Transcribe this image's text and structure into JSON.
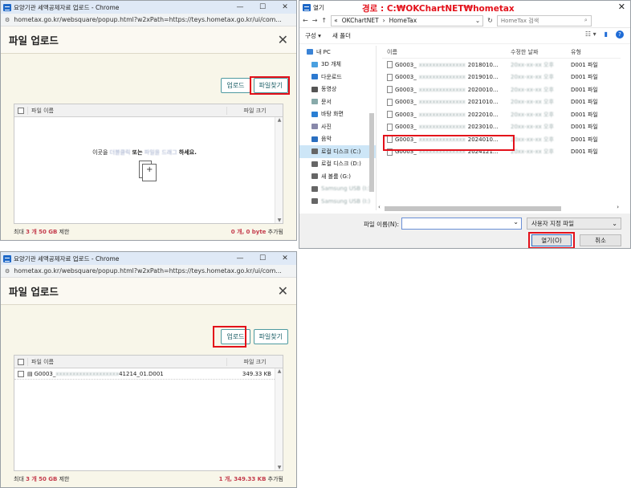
{
  "colors": {
    "highlight": "#e3101a",
    "accent_red": "#c43c4c",
    "teal": "#1b5e66"
  },
  "browser": {
    "title": "요양기관 세액공제자료 업로드 - Chrome",
    "url": "hometax.go.kr/websquare/popup.html?w2xPath=https://teys.hometax.go.kr/ui/com...",
    "minimize": "—",
    "maximize": "☐",
    "close": "✕"
  },
  "upload_before": {
    "heading": "파일 업로드",
    "close": "✕",
    "upload_button": "업로드",
    "find_button": "파일찾기",
    "col_name": "파일 이름",
    "col_size": "파일 크기",
    "hint_pre": "이곳을",
    "hint_blur1": "더블클릭",
    "hint_mid": "또는",
    "hint_blur2": "파일을 드래그",
    "hint_post": "하세요.",
    "footer_pre": "최대",
    "footer_count": "3 개",
    "footer_size": "50 GB",
    "footer_suffix": "제한",
    "added_count": "0 개,",
    "added_size": "0 byte",
    "added_suffix": "추가됨"
  },
  "upload_after": {
    "heading": "파일 업로드",
    "close": "✕",
    "upload_button": "업로드",
    "find_button": "파일찾기",
    "col_name": "파일 이름",
    "col_size": "파일 크기",
    "file_prefix": "G0003_",
    "file_blur": "xxxxxxxxxxxxxxxxxxx",
    "file_suffix": "41214_01.D001",
    "file_size": "349.33 KB",
    "footer_pre": "최대",
    "footer_count": "3 개",
    "footer_size": "50 GB",
    "footer_suffix": "제한",
    "added_count": "1 개,",
    "added_size": "349.33 KB",
    "added_suffix": "추가됨"
  },
  "explorer": {
    "title": "열기",
    "path_note": "경로 : C:₩OKChartNET₩hometax",
    "close": "✕",
    "nav_back": "←",
    "nav_fwd": "→",
    "nav_up": "↑",
    "addr_prefix": "«",
    "addr_1": "OKChartNET",
    "addr_sep": "›",
    "addr_2": "HomeTax",
    "refresh": "↻",
    "search_placeholder": "HomeTax 검색",
    "organize": "구성 ▾",
    "new_folder": "새 폴더",
    "tree": [
      {
        "label": "내 PC",
        "color": "#3a83d6"
      },
      {
        "label": "3D 개체",
        "color": "#4aa0e0"
      },
      {
        "label": "다운로드",
        "color": "#2d7ad0"
      },
      {
        "label": "동영상",
        "color": "#555"
      },
      {
        "label": "문서",
        "color": "#8aa"
      },
      {
        "label": "바탕 화면",
        "color": "#2a7fd4"
      },
      {
        "label": "사진",
        "color": "#88a"
      },
      {
        "label": "음악",
        "color": "#2a6fc0"
      },
      {
        "label": "로컬 디스크 (C:)",
        "color": "#666"
      },
      {
        "label": "로컬 디스크 (D:)",
        "color": "#666"
      },
      {
        "label": "새 볼륨 (G:)",
        "color": "#666"
      },
      {
        "label": "Samsung USB (I:)",
        "color": "#666"
      },
      {
        "label": "Samsung USB (I:)",
        "color": "#666"
      }
    ],
    "col_name": "이름",
    "col_date": "수정한 날짜",
    "col_type": "유형",
    "files": [
      {
        "pre": "G0003_",
        "blur": "xxxxxxxxxxxxxx",
        "suf": "2018010...",
        "date": "20xx-xx-xx 오후",
        "type": "D001 파일"
      },
      {
        "pre": "G0003_",
        "blur": "xxxxxxxxxxxxxx",
        "suf": "2019010...",
        "date": "20xx-xx-xx 오후",
        "type": "D001 파일"
      },
      {
        "pre": "G0003_",
        "blur": "xxxxxxxxxxxxxx",
        "suf": "2020010...",
        "date": "20xx-xx-xx 오후",
        "type": "D001 파일"
      },
      {
        "pre": "G0003_",
        "blur": "xxxxxxxxxxxxxx",
        "suf": "2021010...",
        "date": "20xx-xx-xx 오후",
        "type": "D001 파일"
      },
      {
        "pre": "G0003_",
        "blur": "xxxxxxxxxxxxxx",
        "suf": "2022010...",
        "date": "20xx-xx-xx 오후",
        "type": "D001 파일"
      },
      {
        "pre": "G0003_",
        "blur": "xxxxxxxxxxxxxx",
        "suf": "2023010...",
        "date": "20xx-xx-xx 오후",
        "type": "D001 파일"
      },
      {
        "pre": "G0003_",
        "blur": "xxxxxxxxxxxxxx",
        "suf": "2024010...",
        "date": "20xx-xx-xx 오후",
        "type": "D001 파일"
      },
      {
        "pre": "G0003_",
        "blur": "xxxxxxxxxxxxxx",
        "suf": "2024121...",
        "date": "20xx-xx-xx 오후",
        "type": "D001 파일"
      }
    ],
    "filename_label": "파일 이름(N):",
    "filetype": "사용자 지정 파일",
    "open_button": "열기(O)",
    "cancel_button": "취소"
  }
}
